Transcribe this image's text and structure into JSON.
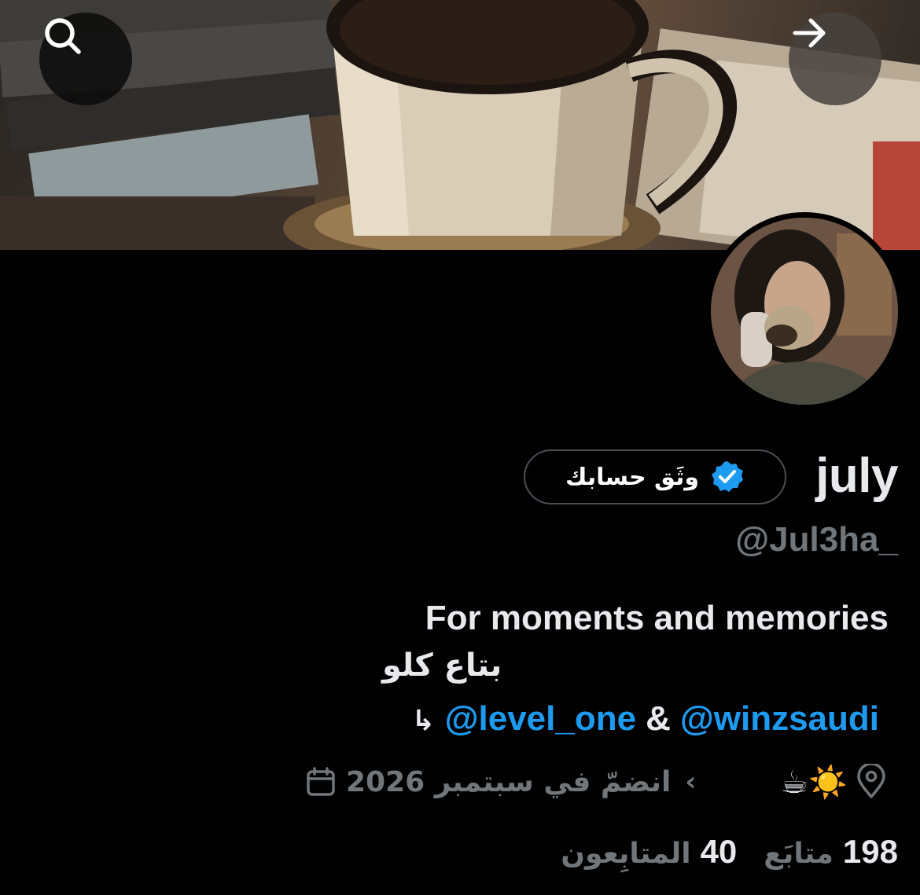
{
  "header": {
    "search_icon": "search-icon",
    "forward_icon": "arrow-right-icon"
  },
  "profile": {
    "display_name": "july",
    "verify_button_label": "وثَق حسابك",
    "handle": "@Jul3ha_",
    "bio": {
      "line1": "For moments and memories",
      "line2": "بتاع كلو",
      "line3_arrow": "↳",
      "mention1": "@level_one",
      "ampersand": "&",
      "mention2": "@winzsaudi"
    },
    "location_emojis": "☕☀️",
    "joined_text": "انضمّ في سبتمبر 2026",
    "following_count": "198",
    "following_label": "متابَع",
    "followers_count": "40",
    "followers_label": "المتابِعون"
  },
  "colors": {
    "background": "#000000",
    "text_primary": "#e7e9ea",
    "text_secondary": "#71767b",
    "link": "#1d9bf0",
    "verified_badge": "#1d9bf0"
  }
}
